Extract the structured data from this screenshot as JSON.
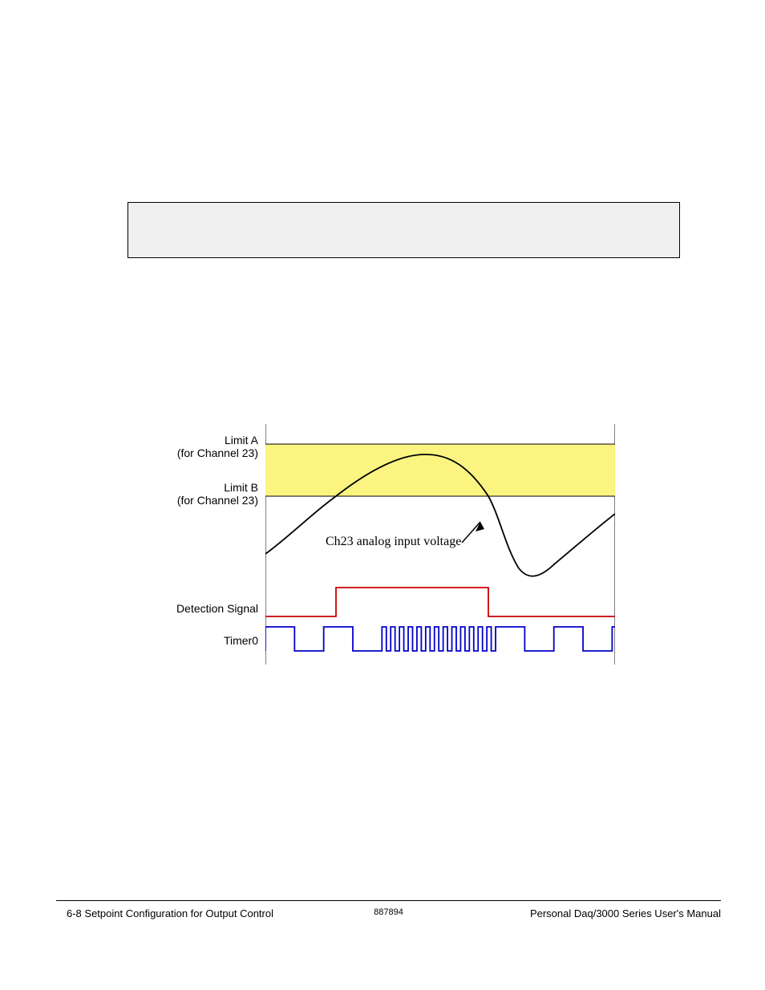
{
  "labels": {
    "limitA_l1": "Limit A",
    "limitA_l2": "(for Channel 23)",
    "limitB_l1": "Limit B",
    "limitB_l2": "(for Channel 23)",
    "annotation": "Ch23 analog input voltage",
    "detection": "Detection Signal",
    "timer": "Timer0"
  },
  "footer": {
    "left": "6-8   Setpoint Configuration for Output Control",
    "center": "887894",
    "right": "Personal Daq/3000 Series User's Manual"
  },
  "chart_data": {
    "type": "line",
    "title": "",
    "xlabel": "",
    "ylabel": "",
    "band": {
      "name": "Limit A–B band",
      "y_top": 1.0,
      "y_bottom": 0.74
    },
    "series": [
      {
        "name": "Ch23 analog input voltage",
        "color": "#000000",
        "x": [
          0,
          0.05,
          0.1,
          0.15,
          0.2,
          0.25,
          0.3,
          0.35,
          0.4,
          0.45,
          0.5,
          0.55,
          0.6,
          0.65,
          0.7,
          0.73,
          0.76,
          0.8,
          0.85,
          0.9,
          0.95,
          1.0
        ],
        "y": [
          0.43,
          0.5,
          0.58,
          0.66,
          0.74,
          0.82,
          0.89,
          0.94,
          0.97,
          0.97,
          0.95,
          0.91,
          0.85,
          0.75,
          0.55,
          0.4,
          0.33,
          0.33,
          0.4,
          0.5,
          0.58,
          0.65
        ]
      },
      {
        "name": "Detection Signal",
        "color": "#cc0000",
        "type": "step",
        "x": [
          0,
          0.2,
          0.2,
          0.64,
          0.64,
          1.0
        ],
        "y": [
          0,
          0,
          1,
          1,
          0,
          0
        ]
      },
      {
        "name": "Timer0",
        "color": "#0000cc",
        "type": "pulse",
        "freq_low": 6,
        "freq_high": 40,
        "high_region": [
          0.2,
          0.64
        ]
      }
    ]
  }
}
